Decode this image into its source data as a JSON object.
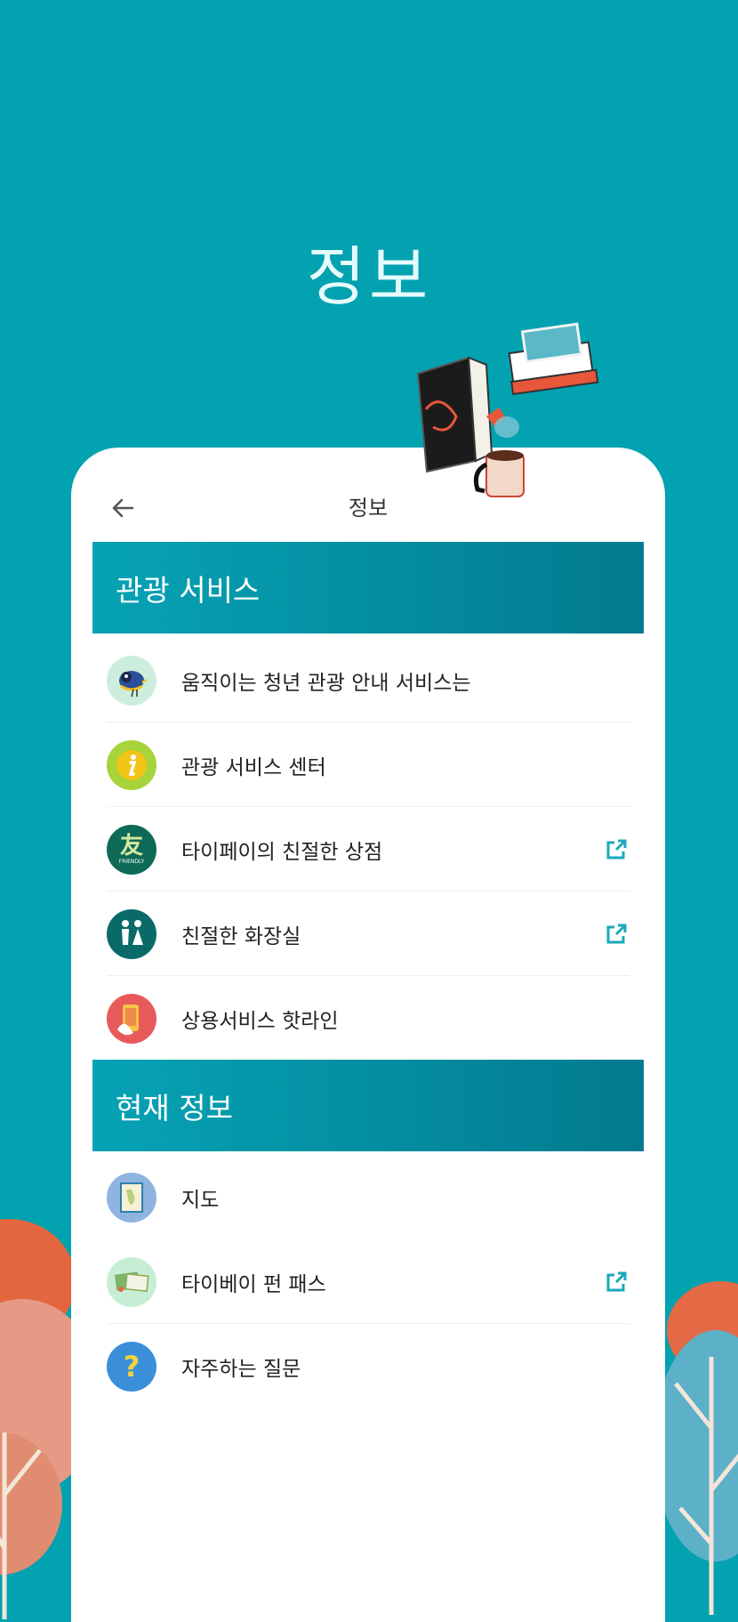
{
  "page": {
    "title": "정보"
  },
  "topbar": {
    "back_icon": "arrow-left-icon",
    "title": "정보"
  },
  "sections": [
    {
      "title": "관광 서비스",
      "items": [
        {
          "label": "움직이는 청년 관광 안내 서비스는",
          "icon": "bird-mascot-icon",
          "external": false
        },
        {
          "label": "관광 서비스 센터",
          "icon": "info-i-icon",
          "external": false
        },
        {
          "label": "타이페이의 친절한 상점",
          "icon": "friendly-store-icon",
          "icon_text": "友",
          "icon_subtext": "FRIENDLY",
          "external": true
        },
        {
          "label": "친절한 화장실",
          "icon": "restroom-icon",
          "external": true
        },
        {
          "label": "상용서비스 핫라인",
          "icon": "phone-hotline-icon",
          "external": false
        }
      ]
    },
    {
      "title": "현재 정보",
      "items": [
        {
          "label": "지도",
          "icon": "map-icon",
          "external": false
        },
        {
          "label": "타이베이 펀 패스",
          "icon": "fun-pass-icon",
          "external": true
        },
        {
          "label": "자주하는 질문",
          "icon": "faq-question-icon",
          "icon_text": "?",
          "external": false
        }
      ]
    }
  ],
  "colors": {
    "background": "#03a2b0",
    "header_gradient_start": "#06a3b5",
    "header_gradient_end": "#037a8f",
    "link_accent": "#1aa9bb"
  }
}
